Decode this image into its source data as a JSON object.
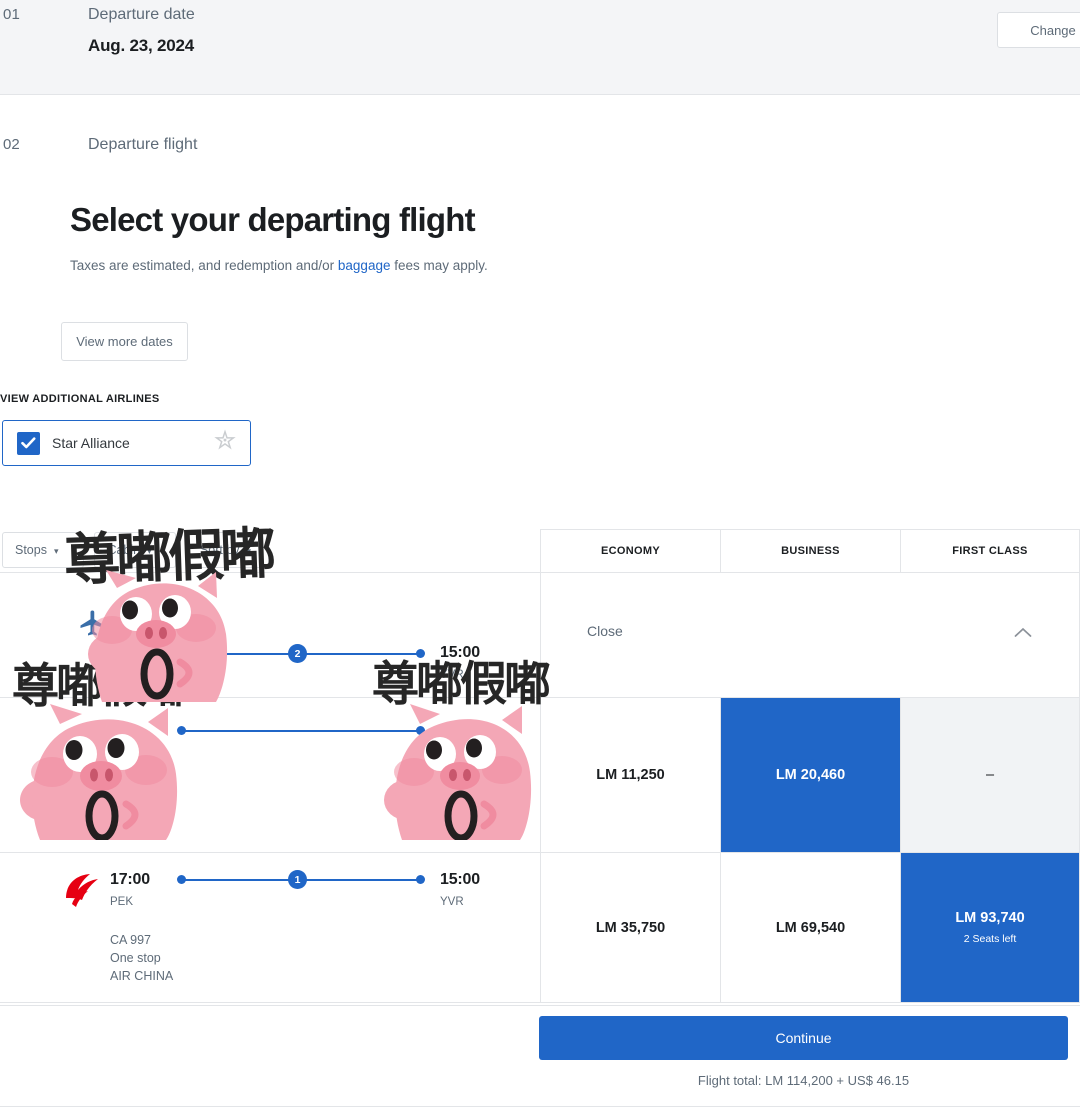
{
  "steps": [
    {
      "number": "01",
      "label": "Departure date",
      "value": "Aug. 23, 2024",
      "action": "Change"
    },
    {
      "number": "02",
      "label": "Departure flight"
    }
  ],
  "header": {
    "title": "Select your departing flight",
    "subtitle_before": "Taxes are estimated, and redemption and/or ",
    "subtitle_link": "baggage",
    "subtitle_after": " fees may apply."
  },
  "controls": {
    "view_more_dates": "View more dates",
    "additional_airlines_label": "VIEW ADDITIONAL AIRLINES",
    "alliance_name": "Star Alliance",
    "alliance_checked": true
  },
  "filters": [
    {
      "label": "Stops",
      "caret": "▾"
    },
    {
      "label": "Cabin",
      "caret": "▾"
    },
    {
      "label": "Sort by",
      "caret": "▾"
    }
  ],
  "table": {
    "columns": [
      "ECONOMY",
      "BUSINESS",
      "FIRST CLASS"
    ],
    "rows": [
      {
        "kind": "expanded",
        "close_label": "Close",
        "depart_time": "",
        "depart_code": "",
        "arrive_time": "15:00",
        "arrive_code": "YVR",
        "stops_badge": "2",
        "flight_number": "",
        "stops_text": "",
        "airline": ""
      },
      {
        "kind": "fares",
        "depart_time": "",
        "depart_code": "",
        "arrive_time": "",
        "arrive_code": "",
        "stops_badge": "",
        "flight_number": "",
        "stops_text": "",
        "airline": "",
        "fares": [
          {
            "price": "LM 11,250",
            "state": "available",
            "note": ""
          },
          {
            "price": "LM 20,460",
            "state": "selected",
            "note": ""
          },
          {
            "price": "–",
            "state": "unavailable",
            "note": ""
          }
        ]
      },
      {
        "kind": "fares",
        "depart_time": "17:00",
        "depart_code": "PEK",
        "arrive_time": "15:00",
        "arrive_code": "YVR",
        "stops_badge": "1",
        "flight_number": "CA 997",
        "stops_text": "One stop",
        "airline": "AIR CHINA",
        "fares": [
          {
            "price": "LM 35,750",
            "state": "available",
            "note": ""
          },
          {
            "price": "LM 69,540",
            "state": "available",
            "note": ""
          },
          {
            "price": "LM 93,740",
            "state": "selected",
            "note": "2 Seats left"
          }
        ]
      }
    ]
  },
  "footer": {
    "continue_label": "Continue",
    "flight_total": "Flight total: LM 114,200 + US$ 46.15"
  },
  "overlays": {
    "calligraphy_text": "尊嘟假嘟"
  },
  "colors": {
    "accent_blue": "#2066c7",
    "text_dark": "#1b1e21",
    "text_muted": "#5e6b78",
    "border": "#e3e5e8",
    "panel_grey": "#f4f5f7",
    "pig_pink": "#f6a8b6",
    "air_china_red": "#e60012"
  }
}
